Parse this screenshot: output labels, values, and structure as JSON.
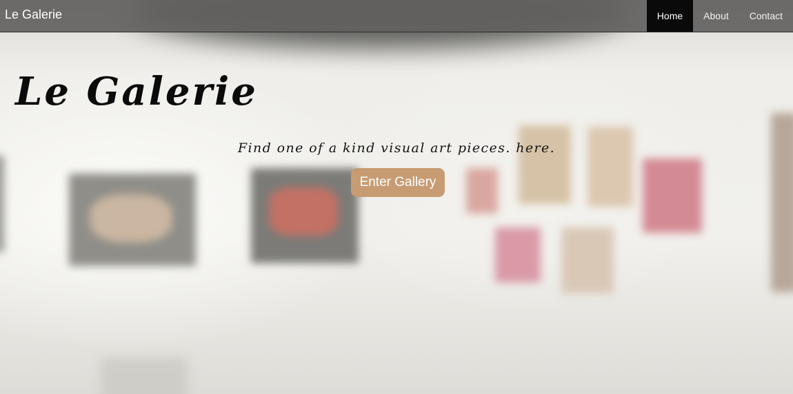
{
  "navbar": {
    "brand": "Le Galerie",
    "links": [
      {
        "label": "Home",
        "active": true
      },
      {
        "label": "About",
        "active": false
      },
      {
        "label": "Contact",
        "active": false
      }
    ],
    "active_color": "#0a0a0a"
  },
  "hero": {
    "title": "Le Galerie",
    "tagline": "Find one of a kind visual art pieces. here.",
    "button_label": "Enter Gallery",
    "button_color": "#c79c73"
  }
}
